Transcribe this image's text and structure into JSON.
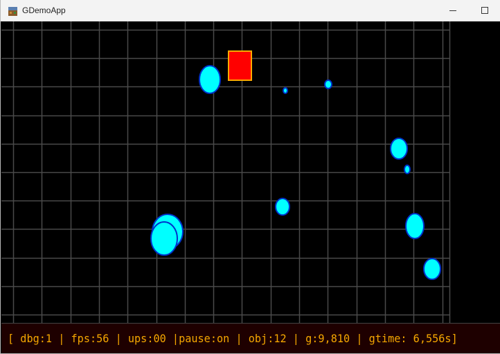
{
  "window": {
    "title": "GDemoApp",
    "icon": "app-icon"
  },
  "controls": {
    "minimize_icon": "minimize-icon",
    "maximize_icon": "maximize-icon",
    "close_icon": "close-icon"
  },
  "colors": {
    "background": "#000000",
    "grid": "#4a4a4a",
    "ball_fill": "#00ffff",
    "ball_stroke": "#0033cc",
    "box_fill": "#ff0000",
    "box_stroke": "#ffaa00",
    "status_bg": "#1e0000",
    "status_text": "#f5a700"
  },
  "scene": {
    "object_count": 12
  },
  "status": {
    "text": "[ dbg:1 | fps:56 | ups:00 |pause:on | obj:12 | g:9,810 | gtime: 6,556s]"
  }
}
